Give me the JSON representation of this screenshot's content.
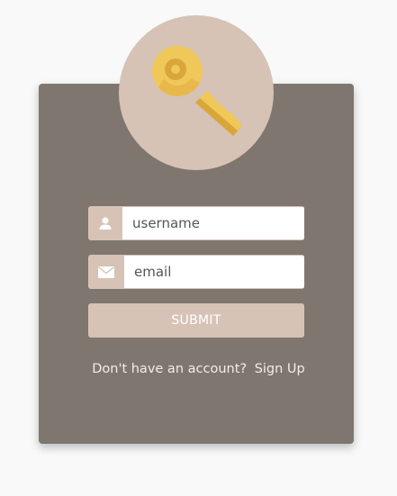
{
  "form": {
    "username_placeholder": "username",
    "email_placeholder": "email",
    "submit_label": "SUBMIT"
  },
  "footer": {
    "prompt": "Don't have an account?",
    "signup_link": "Sign Up"
  },
  "icons": {
    "logo": "key-icon",
    "username": "user-icon",
    "email": "envelope-icon"
  },
  "colors": {
    "page_background": "#f8f9f8",
    "card_background": "#807670",
    "accent": "#d6c3b6",
    "key_gold": "#f0c85a",
    "key_dark_gold": "#d9a63a",
    "text_light": "#f4ece6"
  }
}
